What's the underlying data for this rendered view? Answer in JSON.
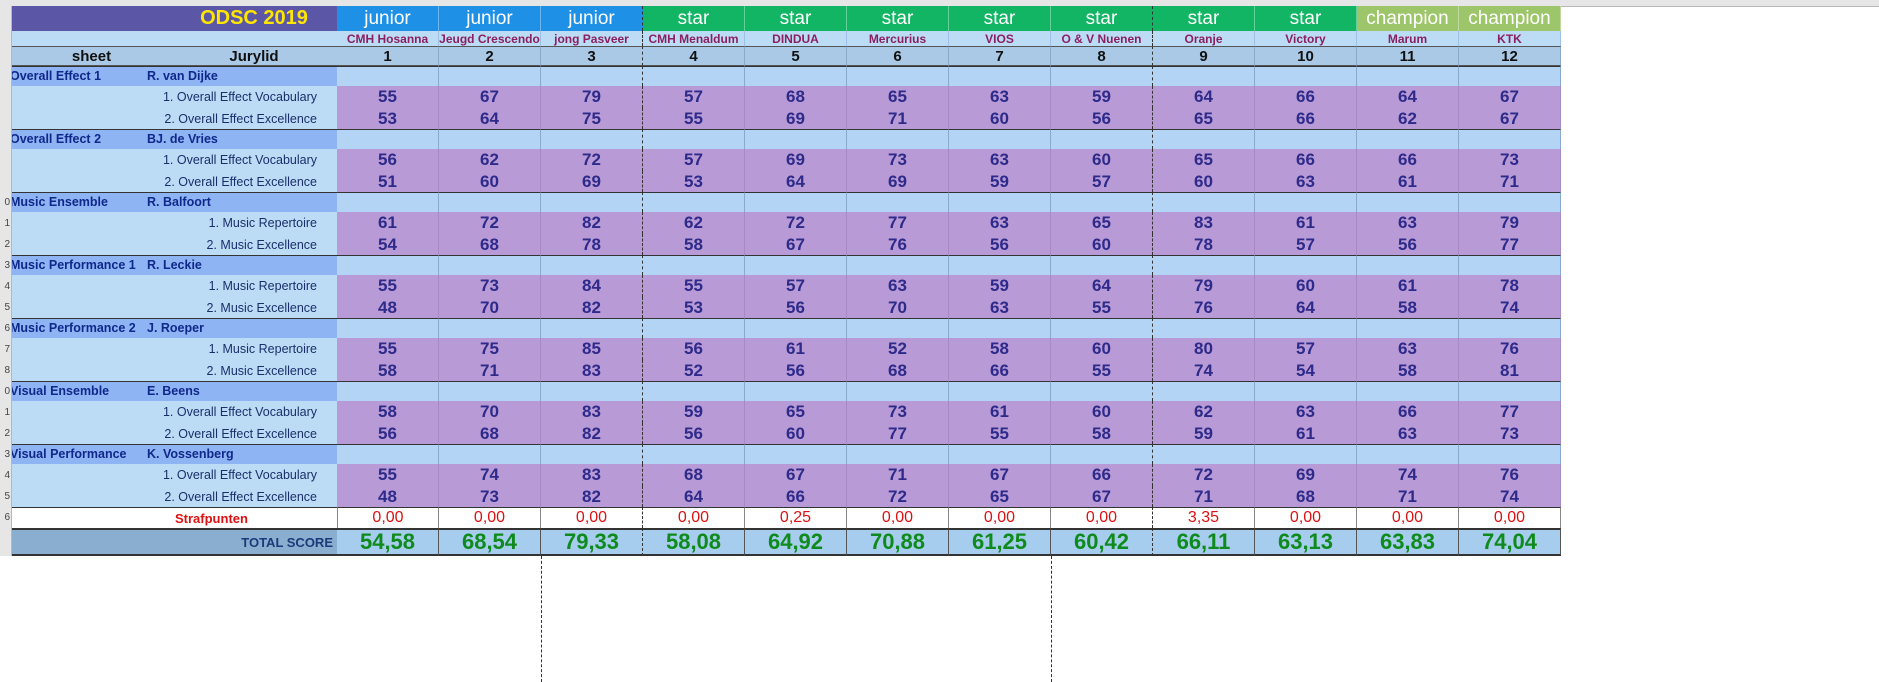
{
  "title": "ODSC 2019",
  "header": {
    "sheet_label": "sheet",
    "jurylid_label": "Jurylid"
  },
  "teams": [
    {
      "class": "junior",
      "name": "CMH Hosanna",
      "number": "1"
    },
    {
      "class": "junior",
      "name": "Jeugd Crescendo",
      "number": "2"
    },
    {
      "class": "junior",
      "name": "jong Pasveer",
      "number": "3"
    },
    {
      "class": "star",
      "name": "CMH Menaldum",
      "number": "4"
    },
    {
      "class": "star",
      "name": "DINDUA",
      "number": "5"
    },
    {
      "class": "star",
      "name": "Mercurius",
      "number": "6"
    },
    {
      "class": "star",
      "name": "VIOS",
      "number": "7"
    },
    {
      "class": "star",
      "name": "O & V Nuenen",
      "number": "8"
    },
    {
      "class": "star",
      "name": "Oranje",
      "number": "9"
    },
    {
      "class": "star",
      "name": "Victory",
      "number": "10"
    },
    {
      "class": "champion",
      "name": "Marum",
      "number": "11"
    },
    {
      "class": "champion",
      "name": "KTK",
      "number": "12"
    }
  ],
  "sections": [
    {
      "name": "Overall Effect 1",
      "judge": "R. van Dijke",
      "rows": [
        {
          "label": "1. Overall Effect Vocabulary",
          "scores": [
            "55",
            "67",
            "79",
            "57",
            "68",
            "65",
            "63",
            "59",
            "64",
            "66",
            "64",
            "67"
          ]
        },
        {
          "label": "2. Overall Effect Excellence",
          "scores": [
            "53",
            "64",
            "75",
            "55",
            "69",
            "71",
            "60",
            "56",
            "65",
            "66",
            "62",
            "67"
          ]
        }
      ]
    },
    {
      "name": "Overall Effect 2",
      "judge": "BJ. de Vries",
      "rows": [
        {
          "label": "1. Overall Effect Vocabulary",
          "scores": [
            "56",
            "62",
            "72",
            "57",
            "69",
            "73",
            "63",
            "60",
            "65",
            "66",
            "66",
            "73"
          ]
        },
        {
          "label": "2. Overall Effect Excellence",
          "scores": [
            "51",
            "60",
            "69",
            "53",
            "64",
            "69",
            "59",
            "57",
            "60",
            "63",
            "61",
            "71"
          ]
        }
      ]
    },
    {
      "name": "Music Ensemble",
      "judge": "R. Balfoort",
      "rows": [
        {
          "label": "1. Music Repertoire",
          "scores": [
            "61",
            "72",
            "82",
            "62",
            "72",
            "77",
            "63",
            "65",
            "83",
            "61",
            "63",
            "79"
          ]
        },
        {
          "label": "2. Music Excellence",
          "scores": [
            "54",
            "68",
            "78",
            "58",
            "67",
            "76",
            "56",
            "60",
            "78",
            "57",
            "56",
            "77"
          ]
        }
      ]
    },
    {
      "name": "Music Performance 1",
      "judge": "R. Leckie",
      "rows": [
        {
          "label": "1. Music Repertoire",
          "scores": [
            "55",
            "73",
            "84",
            "55",
            "57",
            "63",
            "59",
            "64",
            "79",
            "60",
            "61",
            "78"
          ]
        },
        {
          "label": "2. Music Excellence",
          "scores": [
            "48",
            "70",
            "82",
            "53",
            "56",
            "70",
            "63",
            "55",
            "76",
            "64",
            "58",
            "74"
          ]
        }
      ]
    },
    {
      "name": "Music Performance 2",
      "judge": "J. Roeper",
      "rows": [
        {
          "label": "1. Music Repertoire",
          "scores": [
            "55",
            "75",
            "85",
            "56",
            "61",
            "52",
            "58",
            "60",
            "80",
            "57",
            "63",
            "76"
          ]
        },
        {
          "label": "2. Music Excellence",
          "scores": [
            "58",
            "71",
            "83",
            "52",
            "56",
            "68",
            "66",
            "55",
            "74",
            "54",
            "58",
            "81"
          ]
        }
      ]
    },
    {
      "name": "Visual Ensemble",
      "judge": "E. Beens",
      "rows": [
        {
          "label": "1. Overall Effect Vocabulary",
          "scores": [
            "58",
            "70",
            "83",
            "59",
            "65",
            "73",
            "61",
            "60",
            "62",
            "63",
            "66",
            "77"
          ]
        },
        {
          "label": "2. Overall Effect Excellence",
          "scores": [
            "56",
            "68",
            "82",
            "56",
            "60",
            "77",
            "55",
            "58",
            "59",
            "61",
            "63",
            "73"
          ]
        }
      ]
    },
    {
      "name": "Visual Performance",
      "judge": "K. Vossenberg",
      "rows": [
        {
          "label": "1. Overall Effect Vocabulary",
          "scores": [
            "55",
            "74",
            "83",
            "68",
            "67",
            "71",
            "67",
            "66",
            "72",
            "69",
            "74",
            "76"
          ]
        },
        {
          "label": "2. Overall Effect Excellence",
          "scores": [
            "48",
            "73",
            "82",
            "64",
            "66",
            "72",
            "65",
            "67",
            "71",
            "68",
            "71",
            "74"
          ]
        }
      ]
    }
  ],
  "penalties": {
    "label": "Strafpunten",
    "values": [
      "0,00",
      "0,00",
      "0,00",
      "0,00",
      "0,25",
      "0,00",
      "0,00",
      "0,00",
      "3,35",
      "0,00",
      "0,00",
      "0,00"
    ]
  },
  "total": {
    "label": "TOTAL SCORE",
    "values": [
      "54,58",
      "68,54",
      "79,33",
      "58,08",
      "64,92",
      "70,88",
      "61,25",
      "60,42",
      "66,11",
      "63,13",
      "63,83",
      "74,04"
    ]
  },
  "row_numbers": [
    "",
    "",
    "",
    "",
    "",
    "",
    "",
    "",
    "",
    "0",
    "1",
    "2",
    "3",
    "4",
    "5",
    "6",
    "7",
    "8",
    "0",
    "1",
    "2",
    "3",
    "4",
    "5",
    "6"
  ],
  "colors": {
    "junior": "#1e90e6",
    "star": "#12b563",
    "champion": "#9dc56a",
    "title_bg": "#5b57a6",
    "title_text": "#ffe600",
    "section_bg": "#8fb4f4",
    "section_text": "#10288a",
    "score_bg": "#b89ad6",
    "score_text": "#2d2a8a",
    "label_bg": "#bcdcf6",
    "empty_row_bg": "#b4d4f6",
    "team_name_text": "#8a2060",
    "penalty_text": "#dd1111",
    "total_bg": "#a6cdee",
    "total_text": "#0f8a1c",
    "total_label_bg": "#8aaed0",
    "total_label_text": "#1a3a7a"
  }
}
